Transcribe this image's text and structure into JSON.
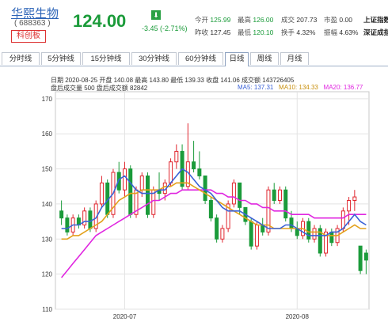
{
  "header": {
    "stock_name": "华熙生物",
    "stock_code": "( 688363 )",
    "board": "科创板",
    "price": "124.00",
    "arrow_icon": "down-arrow-icon",
    "change": "-3.45 (-2.71%)",
    "quote": {
      "open_label": "今开",
      "open": "125.99",
      "high_label": "最高",
      "high": "126.00",
      "volume_label": "成交",
      "volume": "207.73",
      "pe_label": "市盈",
      "pe": "0.00",
      "index_name": "上证指数",
      "prev_label": "昨收",
      "prev": "127.45",
      "low_label": "最低",
      "low": "120.10",
      "turnover_label": "换手",
      "turnover": "4.32%",
      "amplitude_label": "振幅",
      "amplitude": "4.63%",
      "index2_name": "深证成指"
    }
  },
  "tabs": [
    "分时线",
    "5分钟线",
    "15分钟线",
    "30分钟线",
    "60分钟线",
    "日线",
    "周线",
    "月线"
  ],
  "active_tab": "日线",
  "info": {
    "line1": "日期 2020-08-25  开盘 140.08  最高 143.80  最低 139.33  收盘 141.06  成交额 143726405",
    "line2": "盘后成交量 500   盘后成交额 82842",
    "ma5": "MA5: 137.31",
    "ma10": "MA10: 134.33",
    "ma20": "MA20: 136.77"
  },
  "colors": {
    "up": "#e0262e",
    "down": "#1b9b3a",
    "ma5": "#3b62d6",
    "ma10": "#e3a11b",
    "ma20": "#e027e0",
    "grid": "#e3e3e3"
  },
  "chart_data": {
    "type": "candlestick",
    "ylim": [
      110,
      172
    ],
    "yticks": [
      110,
      120,
      130,
      140,
      150,
      160,
      170
    ],
    "xticks": [
      {
        "label": "2020-07",
        "index": 11
      },
      {
        "label": "2020-08",
        "index": 41
      }
    ],
    "candles": [
      [
        138,
        141,
        134,
        136
      ],
      [
        136,
        137,
        131,
        132
      ],
      [
        132,
        137,
        131,
        136
      ],
      [
        136,
        137,
        133,
        134
      ],
      [
        134,
        139,
        133,
        138
      ],
      [
        138,
        139,
        132,
        133
      ],
      [
        133,
        141,
        132,
        140
      ],
      [
        140,
        148,
        139,
        146
      ],
      [
        146,
        147,
        136,
        137
      ],
      [
        137,
        150,
        136,
        149
      ],
      [
        149,
        152,
        143,
        144
      ],
      [
        144,
        152,
        142,
        150
      ],
      [
        150,
        151,
        136,
        137
      ],
      [
        137,
        145,
        136,
        144
      ],
      [
        144,
        149,
        142,
        148
      ],
      [
        148,
        149,
        136,
        137
      ],
      [
        137,
        145,
        136,
        144
      ],
      [
        144,
        149,
        141,
        143
      ],
      [
        143,
        147,
        141,
        146
      ],
      [
        146,
        153,
        145,
        152
      ],
      [
        152,
        157,
        150,
        155
      ],
      [
        155,
        157,
        144,
        145
      ],
      [
        145,
        163,
        144,
        152
      ],
      [
        152,
        158,
        149,
        150
      ],
      [
        150,
        155,
        147,
        148
      ],
      [
        148,
        148,
        140,
        141
      ],
      [
        141,
        142,
        135,
        136
      ],
      [
        136,
        137,
        129,
        130
      ],
      [
        130,
        134,
        129,
        133
      ],
      [
        133,
        141,
        132,
        140
      ],
      [
        140,
        147,
        139,
        146
      ],
      [
        146,
        146,
        137,
        139
      ],
      [
        139,
        139,
        134,
        135
      ],
      [
        135,
        136,
        127,
        128
      ],
      [
        128,
        135,
        127,
        134
      ],
      [
        134,
        136,
        131,
        132
      ],
      [
        132,
        145,
        131,
        144
      ],
      [
        144,
        146,
        140,
        141
      ],
      [
        141,
        145,
        140,
        144
      ],
      [
        144,
        145,
        135,
        136
      ],
      [
        136,
        138,
        132,
        133
      ],
      [
        133,
        135,
        130,
        131
      ],
      [
        131,
        136,
        130,
        135
      ],
      [
        135,
        136,
        129,
        130
      ],
      [
        130,
        134,
        129,
        133
      ],
      [
        133,
        134,
        125,
        126
      ],
      [
        126,
        133,
        125,
        132
      ],
      [
        132,
        133,
        128,
        129
      ],
      [
        129,
        134,
        128,
        133
      ],
      [
        133,
        139,
        132,
        138
      ],
      [
        138,
        142,
        134,
        141
      ],
      [
        141,
        144,
        138,
        142
      ],
      [
        128,
        128,
        120,
        121
      ],
      [
        126,
        127,
        120,
        124
      ]
    ],
    "ma5": [
      133,
      133,
      134,
      134,
      135,
      135,
      136,
      139,
      141,
      143,
      147,
      148,
      146,
      144,
      143,
      143,
      143,
      144,
      144,
      146,
      148,
      150,
      149,
      147,
      145,
      144,
      143,
      141,
      139,
      138,
      138,
      138,
      137,
      136,
      135,
      134,
      133,
      133,
      133,
      134,
      134,
      133,
      132,
      131,
      131,
      131,
      131,
      132,
      132,
      133,
      135,
      137,
      135,
      134
    ],
    "ma10": [
      130,
      130,
      131,
      131,
      132,
      133,
      134,
      135,
      137,
      139,
      141,
      142,
      143,
      143,
      144,
      144,
      144,
      144,
      145,
      145,
      146,
      146,
      146,
      145,
      144,
      143,
      142,
      141,
      140,
      139,
      138,
      137,
      136,
      135,
      134,
      134,
      134,
      133,
      133,
      133,
      133,
      133,
      133,
      132,
      132,
      132,
      131,
      131,
      131,
      132,
      133,
      134,
      133,
      133
    ],
    "ma20": [
      119,
      121,
      123,
      125,
      127,
      129,
      131,
      132,
      133,
      134,
      135,
      136,
      137,
      138,
      139,
      140,
      141,
      141,
      142,
      143,
      143,
      144,
      144,
      144,
      144,
      144,
      144,
      143,
      143,
      142,
      142,
      141,
      141,
      140,
      140,
      139,
      139,
      138,
      138,
      138,
      137,
      137,
      137,
      137,
      136,
      136,
      136,
      136,
      136,
      136,
      137,
      137,
      137,
      137
    ]
  }
}
